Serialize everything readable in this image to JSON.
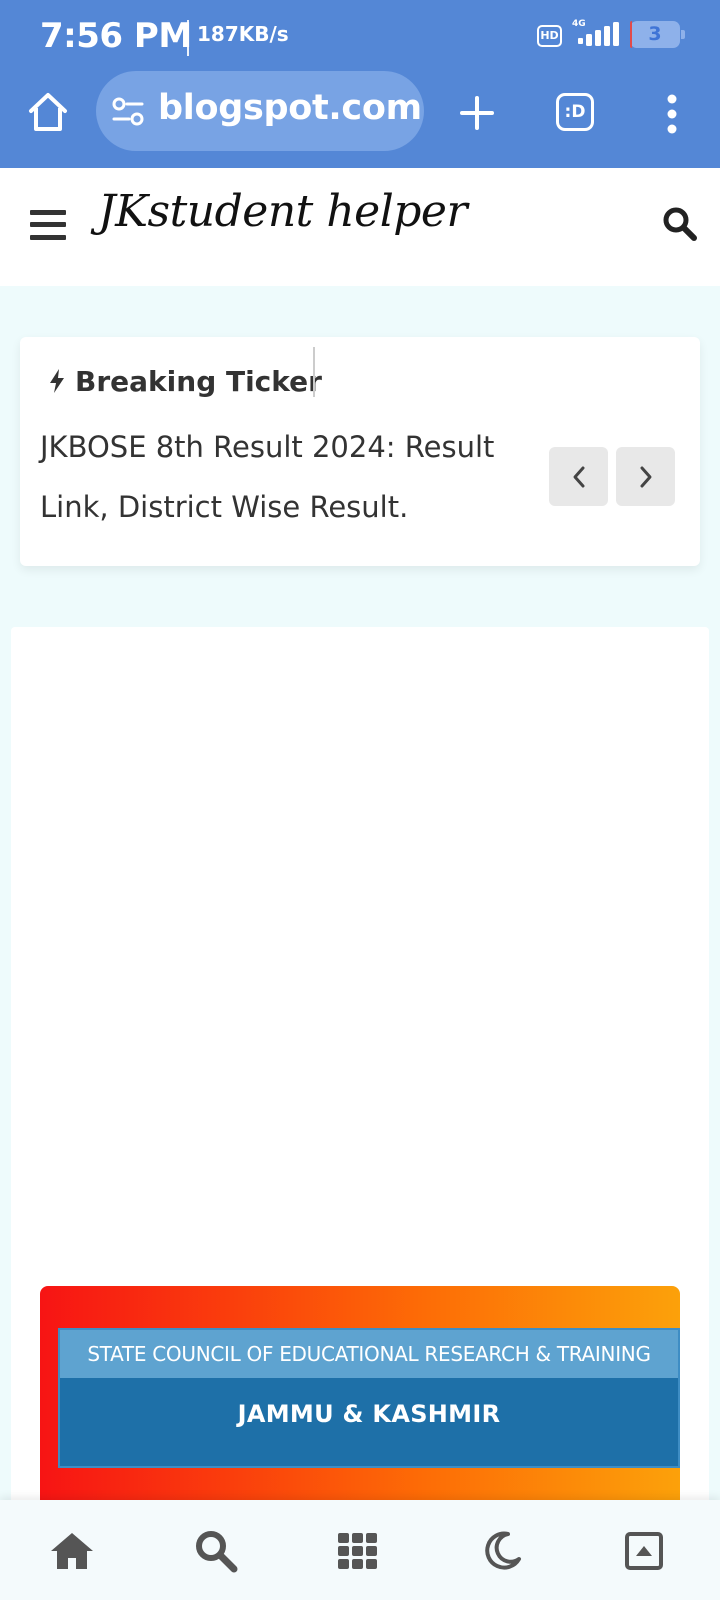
{
  "status_bar": {
    "time": "7:56 PM",
    "speed": "187KB/s",
    "hd_label": "HD",
    "network_label": "4G",
    "battery_level": "3",
    "icons": [
      "hd-icon",
      "signal-icon",
      "battery-icon"
    ]
  },
  "browser": {
    "url": "blogspot.com",
    "tabs_label": ":D",
    "icons": [
      "home-icon",
      "site-settings-icon",
      "plus-icon",
      "tabs-icon",
      "more-vert-icon"
    ]
  },
  "site": {
    "logo": "JKstudent helper",
    "icons": [
      "hamburger-menu-icon",
      "search-icon"
    ]
  },
  "ticker": {
    "title": "Breaking Ticker",
    "headline": "JKBOSE 8th Result 2024: Result Link, District Wise Result.",
    "icons": [
      "bolt-icon",
      "chevron-left-icon",
      "chevron-right-icon"
    ]
  },
  "banner": {
    "line1": "STATE COUNCIL OF EDUCATIONAL RESEARCH & TRAINING",
    "line2": "JAMMU & KASHMIR"
  },
  "bottom_nav": {
    "items": [
      "home-icon",
      "search-icon",
      "grid-icon",
      "moon-icon",
      "scroll-top-icon"
    ]
  },
  "colors": {
    "toolbar": "#5487d6",
    "page_background": "#eefbfc",
    "banner_gradient_start": "#f71414",
    "banner_gradient_end": "#fca10a",
    "banner_panel": "#1e70a8"
  }
}
